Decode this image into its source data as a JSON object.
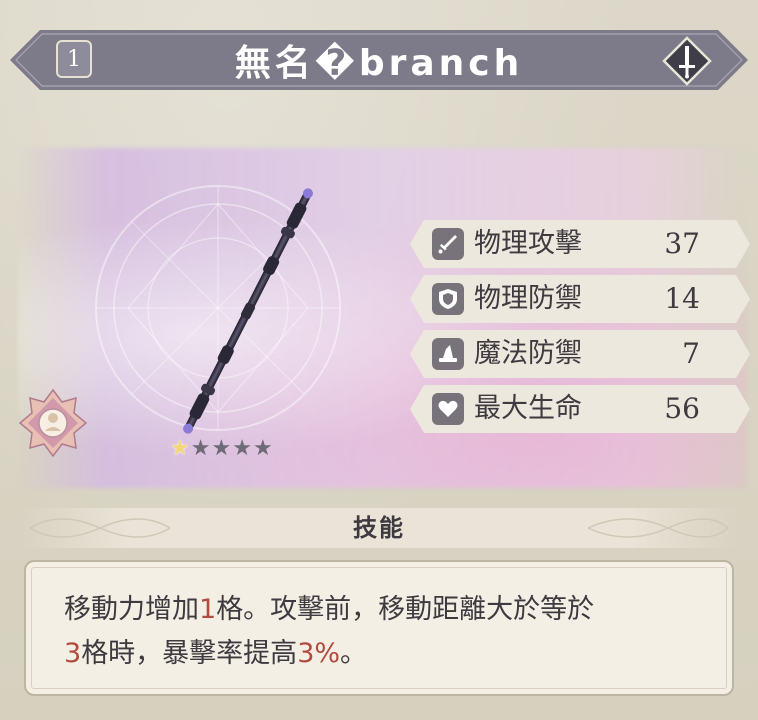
{
  "header": {
    "level": "1",
    "weapon_name": "無名�branch"
  },
  "rarity": {
    "filled_stars": 1,
    "total_stars": 5,
    "filled_symbol": "★",
    "empty_symbol": "★"
  },
  "stats": [
    {
      "icon": "sword-icon",
      "label": "物理攻擊",
      "value": "37"
    },
    {
      "icon": "shield-icon",
      "label": "物理防禦",
      "value": "14"
    },
    {
      "icon": "wizard-hat-icon",
      "label": "魔法防禦",
      "value": "7"
    },
    {
      "icon": "heart-icon",
      "label": "最大生命",
      "value": "56"
    }
  ],
  "skill": {
    "title": "技能",
    "segments": [
      {
        "text": "移動力增加",
        "highlight": false
      },
      {
        "text": "1",
        "highlight": true
      },
      {
        "text": "格。攻擊前，移動距離大於等於",
        "highlight": false
      },
      {
        "text": "3",
        "highlight": true
      },
      {
        "text": "格時，暴擊率提高",
        "highlight": false
      },
      {
        "text": "3%",
        "highlight": true
      },
      {
        "text": "。",
        "highlight": false
      }
    ]
  },
  "colors": {
    "banner": "#7d7b89",
    "stat_plate": "#ede8dd",
    "highlight": "#b24a3d",
    "text": "#3e3a40"
  }
}
